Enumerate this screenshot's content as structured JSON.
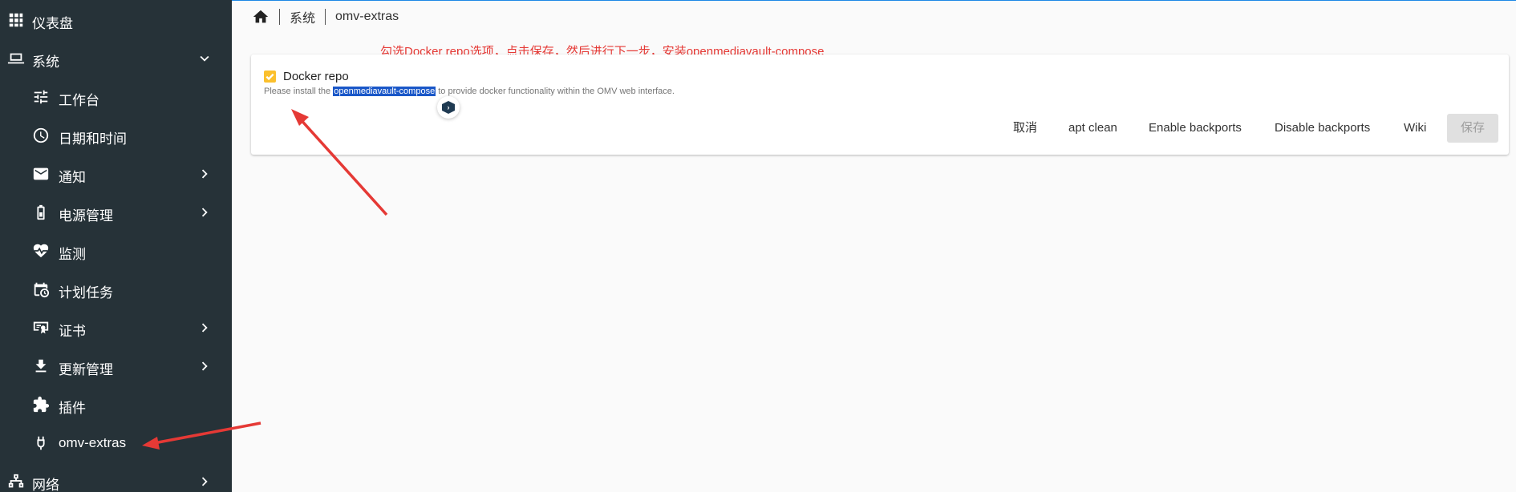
{
  "sidebar": {
    "items": [
      {
        "label": "仪表盘",
        "icon": "dashboard-grid-icon",
        "chevron": ""
      },
      {
        "label": "系统",
        "icon": "laptop-icon",
        "chevron": "down"
      },
      {
        "label": "工作台",
        "icon": "tune-icon",
        "chevron": ""
      },
      {
        "label": "日期和时间",
        "icon": "clock-icon",
        "chevron": ""
      },
      {
        "label": "通知",
        "icon": "mail-icon",
        "chevron": "right"
      },
      {
        "label": "电源管理",
        "icon": "battery-icon",
        "chevron": "right"
      },
      {
        "label": "监测",
        "icon": "heart-pulse-icon",
        "chevron": ""
      },
      {
        "label": "计划任务",
        "icon": "calendar-clock-icon",
        "chevron": ""
      },
      {
        "label": "证书",
        "icon": "certificate-icon",
        "chevron": "right"
      },
      {
        "label": "更新管理",
        "icon": "download-icon",
        "chevron": "right"
      },
      {
        "label": "插件",
        "icon": "puzzle-icon",
        "chevron": ""
      },
      {
        "label": "omv-extras",
        "icon": "power-plug-icon",
        "chevron": ""
      },
      {
        "label": "网络",
        "icon": "network-icon",
        "chevron": "right"
      }
    ]
  },
  "breadcrumb": {
    "home_icon": "home-icon",
    "items": [
      "系统",
      "omv-extras"
    ]
  },
  "annotation": {
    "text": "勾选Docker repo选项，点击保存，然后进行下一步，安装openmediavault-compose",
    "color": "#e53935"
  },
  "card": {
    "checkbox_label": "Docker repo",
    "checkbox_checked": true,
    "hint_before": "Please install the ",
    "hint_selected": "openmediavault-compose",
    "hint_after": " to provide docker functionality within the OMV web interface.",
    "buttons": {
      "cancel": "取消",
      "apt_clean": "apt clean",
      "enable_backports": "Enable backports",
      "disable_backports": "Disable backports",
      "wiki": "Wiki",
      "save": "保存"
    }
  },
  "colors": {
    "sidebar_bg": "#263238",
    "checkbox": "#fbc02d",
    "selection": "#1a57c8",
    "arrow": "#e53935"
  }
}
